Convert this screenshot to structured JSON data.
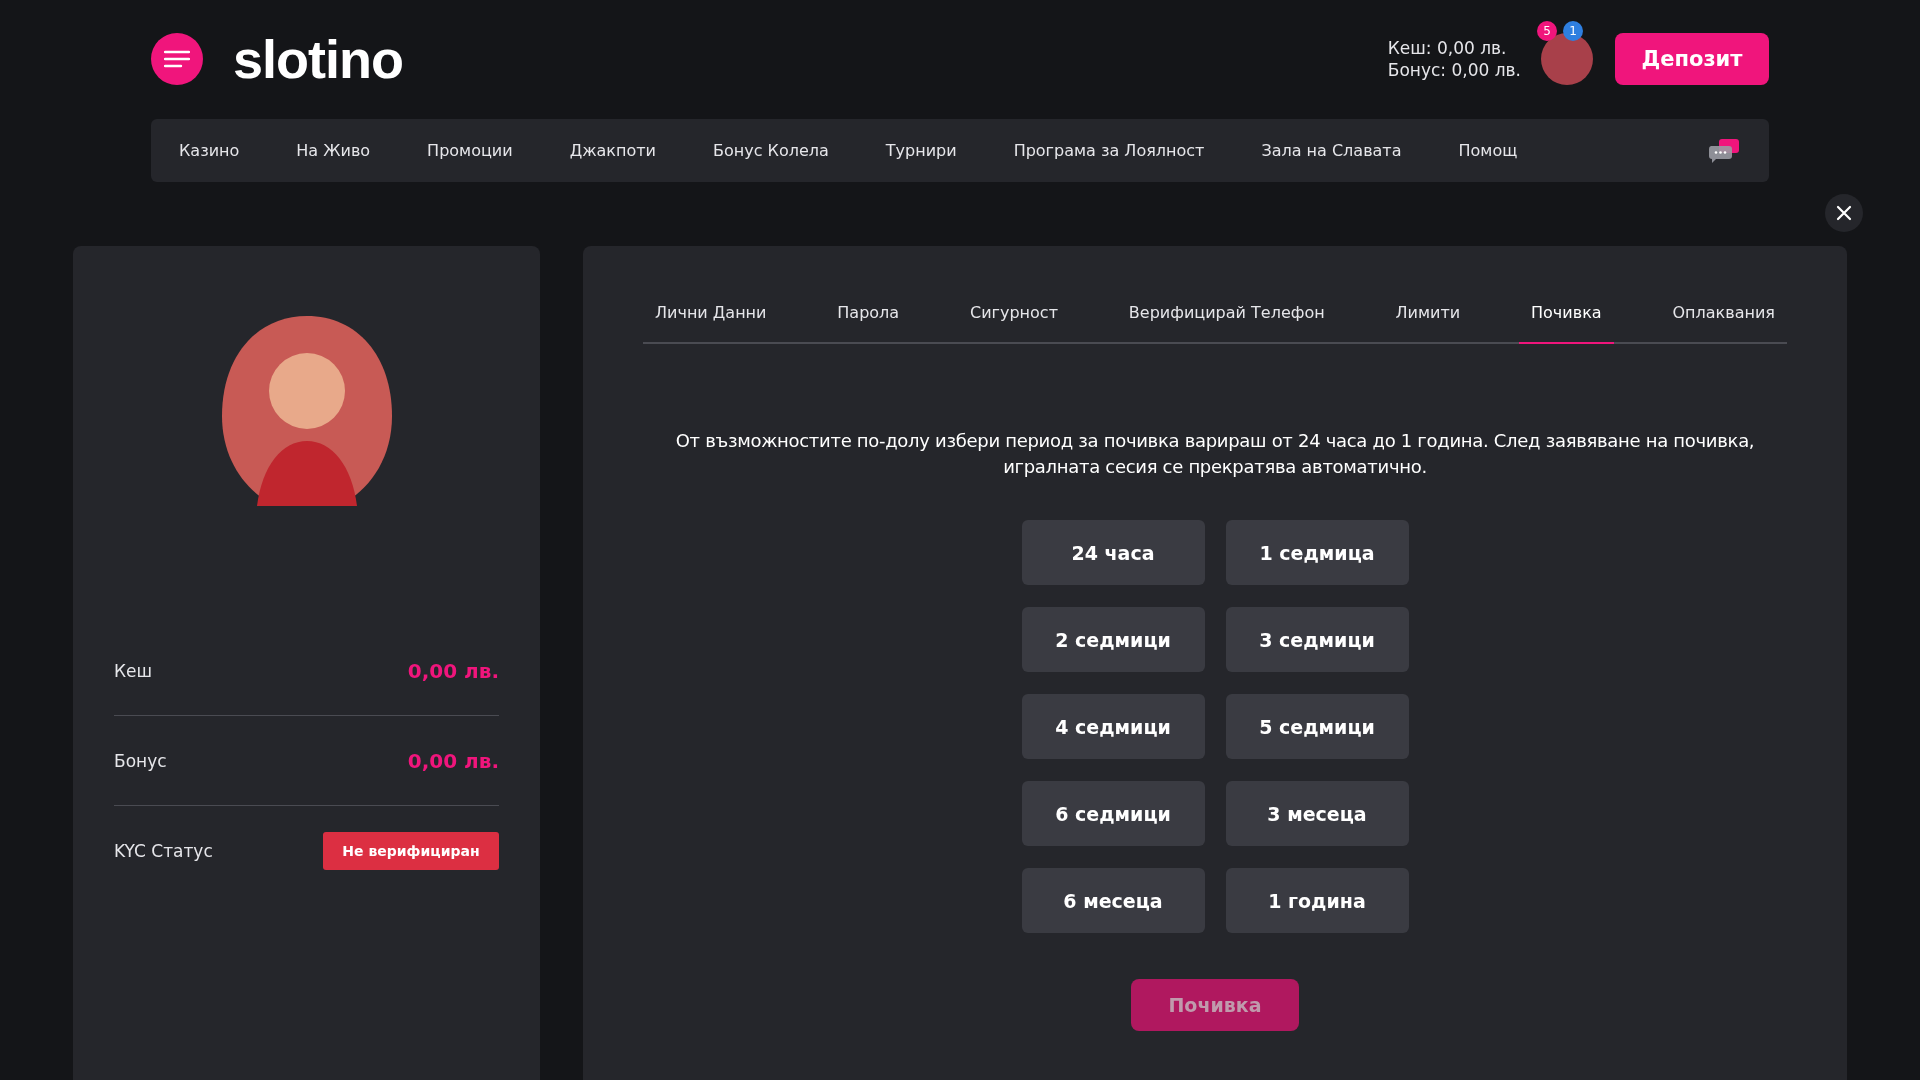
{
  "header": {
    "logo": "slotino",
    "balance_lines": [
      "Кеш: 0,00 лв.",
      "Бонус: 0,00 лв."
    ],
    "avatar_badges": [
      {
        "text": "5",
        "color": "#f0157c"
      },
      {
        "text": "1",
        "color": "#2f7fe0"
      }
    ],
    "deposit_button": "Депозит"
  },
  "nav": {
    "items": [
      "Казино",
      "На Живо",
      "Промоции",
      "Джакпоти",
      "Бонус Колела",
      "Турнири",
      "Програма за Лоялност",
      "Зала на Славата",
      "Помощ"
    ]
  },
  "profile": {
    "rows": [
      {
        "kind": "amount",
        "label": "Кеш",
        "value": "0,00 лв."
      },
      {
        "kind": "amount",
        "label": "Бонус",
        "value": "0,00 лв."
      },
      {
        "kind": "status",
        "label": "KYC Статус",
        "value": "Не верифициран"
      }
    ]
  },
  "tabs": [
    {
      "label": "Лични Данни",
      "selected": false
    },
    {
      "label": "Парола",
      "selected": false
    },
    {
      "label": "Сигурност",
      "selected": false
    },
    {
      "label": "Верифицирай Телефон",
      "selected": false
    },
    {
      "label": "Лимити",
      "selected": false
    },
    {
      "label": "Почивка",
      "selected": true
    },
    {
      "label": "Оплаквания",
      "selected": false
    }
  ],
  "break": {
    "description": "От възможностите по-долу избери период за почивка варираш от 24 часа до 1 година. След заявяване на почивка, игралната сесия се прекратява автоматично.",
    "periods": [
      {
        "label": "24 часа",
        "selected": false
      },
      {
        "label": "1 седмица",
        "selected": false
      },
      {
        "label": "2 седмици",
        "selected": false
      },
      {
        "label": "3 седмици",
        "selected": false
      },
      {
        "label": "4 седмици",
        "selected": false
      },
      {
        "label": "5 седмици",
        "selected": false
      },
      {
        "label": "6 седмици",
        "selected": false
      },
      {
        "label": "3 месеца",
        "selected": false
      },
      {
        "label": "6 месеца",
        "selected": false
      },
      {
        "label": "1 година",
        "selected": false
      }
    ],
    "submit": {
      "label": "Почивка",
      "disabled": true
    }
  }
}
